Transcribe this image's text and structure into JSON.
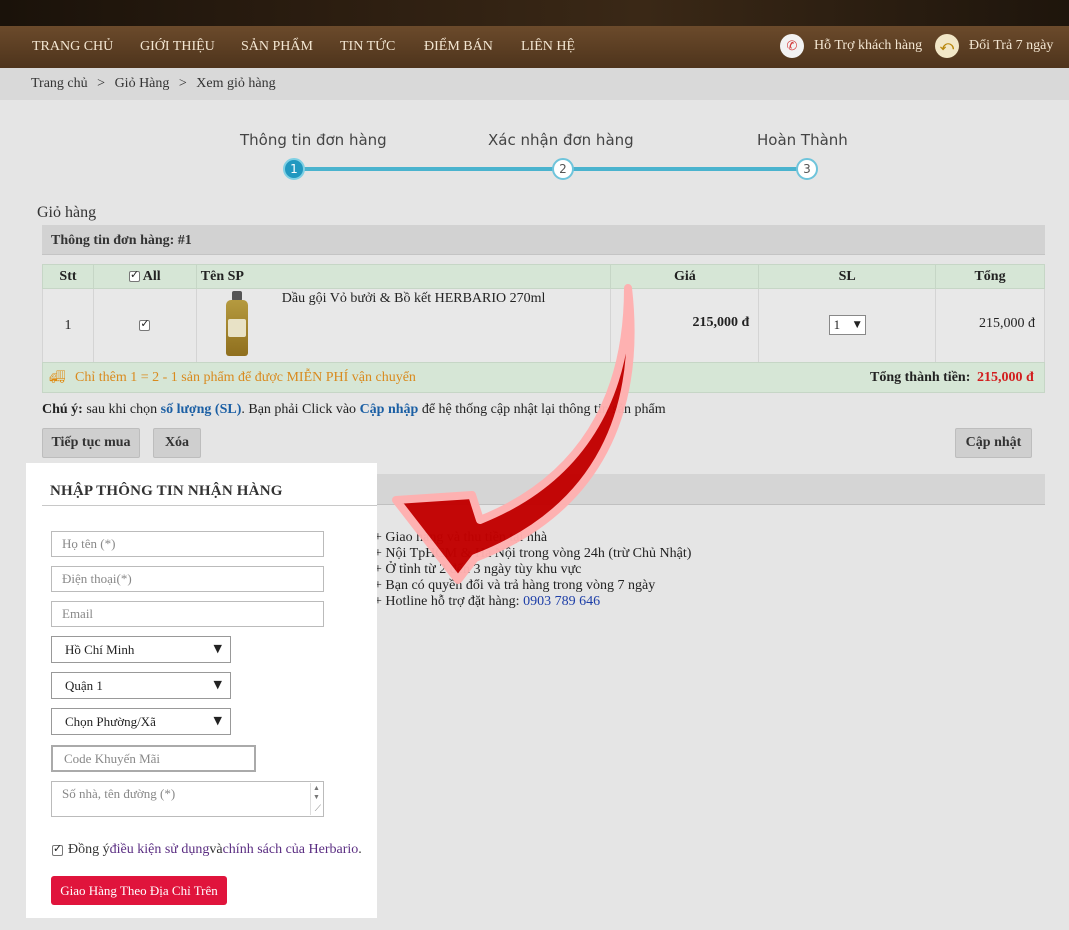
{
  "nav": {
    "items": [
      "TRANG CHỦ",
      "GIỚI THIỆU",
      "SẢN PHẨM",
      "TIN TỨC",
      "ĐIỂM BÁN",
      "LIÊN HỆ"
    ],
    "support": "Hỗ Trợ khách hàng",
    "returns": "Đổi Trả 7 ngày",
    "icons": {
      "support": "phone-icon",
      "returns": "return-box-icon"
    }
  },
  "breadcrumb": [
    "Trang chủ",
    ">",
    "Giỏ Hàng",
    ">",
    "Xem giỏ hàng"
  ],
  "steps": [
    {
      "label": "Thông tin đơn hàng",
      "num": "1",
      "active": true
    },
    {
      "label": "Xác nhận đơn hàng",
      "num": "2",
      "active": false
    },
    {
      "label": "Hoàn Thành",
      "num": "3",
      "active": false
    }
  ],
  "cart": {
    "title": "Giỏ hàng",
    "order_header": "Thông tin đơn hàng: #1",
    "columns": [
      "Stt",
      "All",
      "Tên SP",
      "Giá",
      "SL",
      "Tổng"
    ],
    "rows": [
      {
        "stt": "1",
        "name": "Dầu gội Vỏ bưởi & Bồ kết HERBARIO 270ml",
        "price": "215,000 đ",
        "qty": "1",
        "total": "215,000 đ"
      }
    ],
    "shipping_msg": "Chỉ thêm 1 = 2 - 1 sản phẩm để được MIỄN PHÍ vận chuyển",
    "total_label": "Tổng thành tiền:",
    "total_value": "215,000 đ"
  },
  "note": {
    "prefix": "Chú ý:",
    "t1": " sau khi chọn ",
    "link1": "số lượng (SL)",
    "t2": ". Bạn phải Click vào ",
    "link2": "Cập nhập",
    "t3": " để hệ thống cập nhật lại thông tin sản phẩm"
  },
  "buttons": {
    "continue": "Tiếp tục mua",
    "delete": "Xóa",
    "update": "Cập nhật"
  },
  "form": {
    "title": "NHẬP THÔNG TIN NHẬN HÀNG",
    "name_ph": "Họ tên (*)",
    "phone_ph": "Điện thoại(*)",
    "email_ph": "Email",
    "city": "Hồ Chí Minh",
    "district": "Quận 1",
    "ward": "Chọn Phường/Xã",
    "promo_ph": "Code Khuyến Mãi",
    "address_ph": "Số nhà, tên đường (*)",
    "agree_prefix": "Đồng ý ",
    "agree_link1": "điều kiện sử dụng",
    "agree_mid": " và ",
    "agree_link2": "chính sách của Herbario",
    "agree_suffix": ".",
    "submit": "Giao Hàng Theo Địa Chỉ Trên"
  },
  "info": {
    "lines": [
      "+ Giao hàng và thu tiền tại nhà",
      "+ Nội TpHCM & Hà Nội trong vòng 24h (trừ Chủ Nhật)",
      "+ Ở tỉnh từ 2 đến 3 ngày tùy khu vực",
      "+ Bạn có quyền đổi và trả hàng trong vòng 7 ngày"
    ],
    "hotline_label": "+ Hotline hỗ trợ đặt hàng: ",
    "hotline": "0903 789 646"
  },
  "colors": {
    "accent": "#2198c0",
    "price_red": "#d21d1d",
    "submit": "#e0143c",
    "arrow": "#c20000"
  }
}
